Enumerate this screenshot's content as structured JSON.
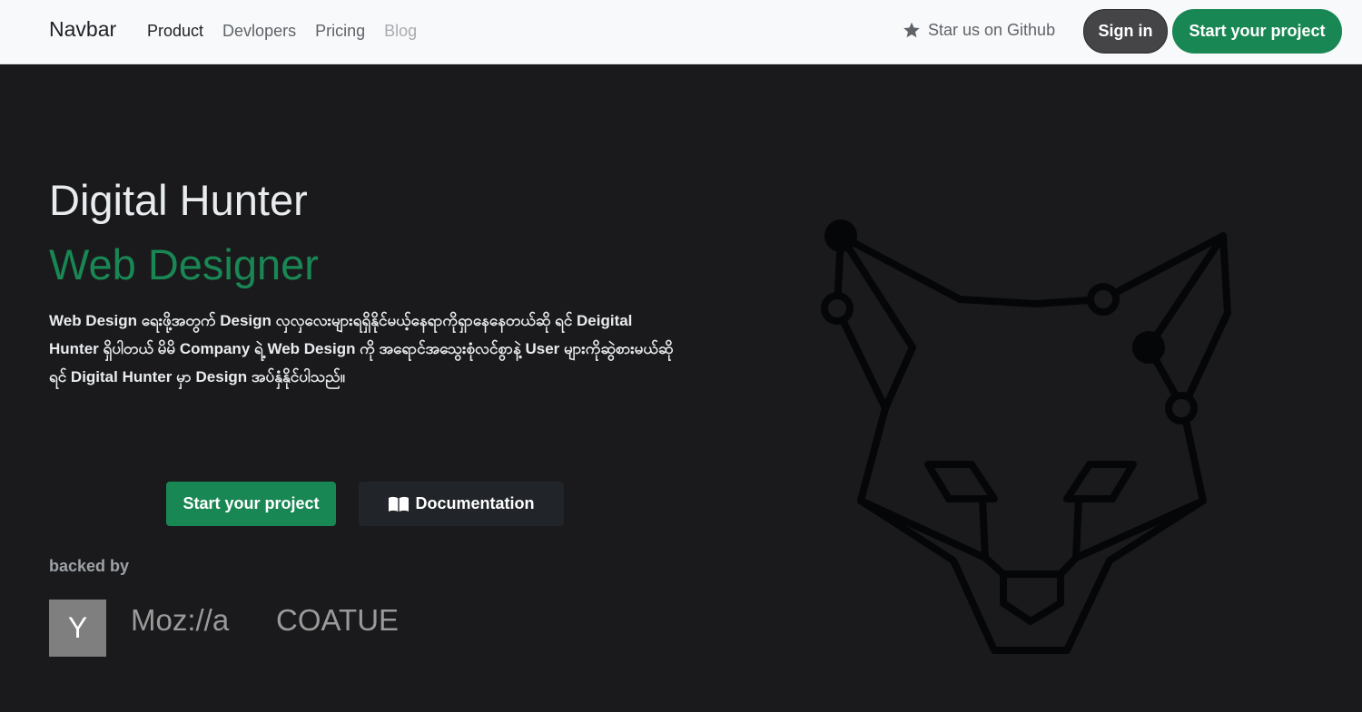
{
  "navbar": {
    "brand": "Navbar",
    "links": [
      {
        "label": "Product",
        "state": "active"
      },
      {
        "label": "Devlopers",
        "state": "normal"
      },
      {
        "label": "Pricing",
        "state": "normal"
      },
      {
        "label": "Blog",
        "state": "disabled"
      }
    ],
    "star_label": "Star us on Github",
    "star_icon": "star-icon",
    "signin_label": "Sign in",
    "start_label": "Start your project"
  },
  "hero": {
    "title": "Digital Hunter",
    "subtitle": "Web Designer",
    "description": "Web Design ရေးဖို့အတွက် Design လှလှလေးများရရှိနိုင်မယ့်နေရာကိုရှာနေနေတယ်ဆို ရင် Deigital Hunter ရှိပါတယ် မိမိ Company ရဲ့ Web Design ကို အရောင်အသွေးစုံလင်စွာနဲ့ User များကိုဆွဲစားမယ်ဆိုရင် Digital Hunter မှာ Design အပ်နှံနိုင်ပါသည်။",
    "start_label": "Start your project",
    "docs_label": "Documentation",
    "docs_icon": "book-icon",
    "illustration": "fox-head-line-art"
  },
  "backed": {
    "label": "backed by",
    "logos": [
      "Y",
      "Moz://a",
      "COATUE"
    ]
  },
  "colors": {
    "primary": "#198754",
    "background": "#1a1a1c",
    "navbar_bg": "#f8f9fa",
    "dark_button": "#212529"
  }
}
